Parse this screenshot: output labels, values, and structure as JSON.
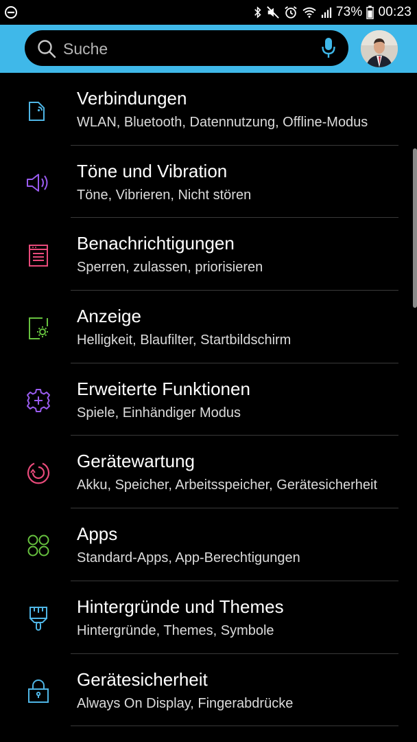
{
  "status_bar": {
    "battery": "73%",
    "time": "00:23"
  },
  "search": {
    "placeholder": "Suche"
  },
  "colors": {
    "header": "#3fb8e9",
    "background": "#000000"
  },
  "items": [
    {
      "title": "Verbindungen",
      "subtitle": "WLAN, Bluetooth, Datennutzung, Offline-Modus",
      "icon": "connections-icon",
      "color": "#4fb6e6"
    },
    {
      "title": "Töne und Vibration",
      "subtitle": "Töne, Vibrieren, Nicht stören",
      "icon": "speaker-icon",
      "color": "#9a5cf0"
    },
    {
      "title": "Benachrichtigungen",
      "subtitle": "Sperren, zulassen, priorisieren",
      "icon": "notifications-icon",
      "color": "#e84a7a"
    },
    {
      "title": "Anzeige",
      "subtitle": "Helligkeit, Blaufilter, Startbildschirm",
      "icon": "display-icon",
      "color": "#67c23f"
    },
    {
      "title": "Erweiterte Funktionen",
      "subtitle": "Spiele, Einhändiger Modus",
      "icon": "gear-plus-icon",
      "color": "#9a5cf0"
    },
    {
      "title": "Gerätewartung",
      "subtitle": "Akku, Speicher, Arbeitsspeicher, Gerätesicherheit",
      "icon": "device-maintenance-icon",
      "color": "#e84a7a"
    },
    {
      "title": "Apps",
      "subtitle": "Standard-Apps, App-Berechtigungen",
      "icon": "apps-icon",
      "color": "#67c23f"
    },
    {
      "title": "Hintergründe und Themes",
      "subtitle": "Hintergründe, Themes, Symbole",
      "icon": "brush-icon",
      "color": "#4fb6e6"
    },
    {
      "title": "Gerätesicherheit",
      "subtitle": "Always On Display, Fingerabdrücke",
      "icon": "lock-icon",
      "color": "#4fb6e6"
    }
  ]
}
